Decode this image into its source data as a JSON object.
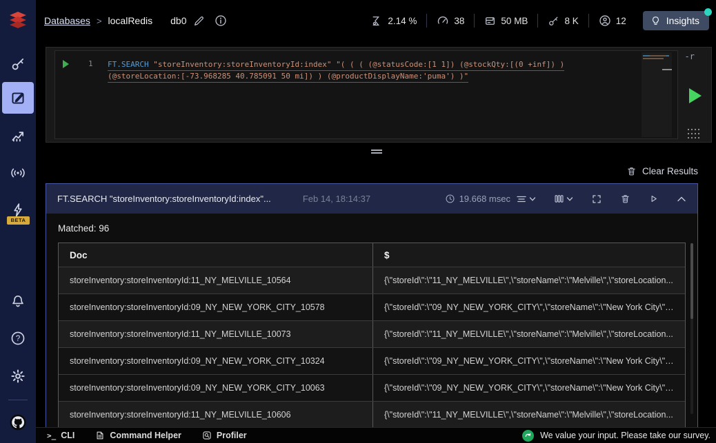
{
  "topbar": {
    "breadcrumb": {
      "databases": "Databases",
      "separator": ">",
      "database_name": "localRedis"
    },
    "db_index": "db0",
    "stats": {
      "cpu": "2.14 %",
      "commands_per_sec": "38",
      "total_memory": "50 MB",
      "total_keys": "8 K",
      "connected_clients": "12"
    },
    "insights_button": "Insights"
  },
  "sidebar": {
    "beta_badge": "BETA"
  },
  "workbench": {
    "editor": {
      "line_number": "1",
      "keyword": "FT.SEARCH",
      "code_line1_rest": " \"storeInventory:storeInventoryId:index\" \"( ( ( (@statusCode:[1 1]) (@stockQty:[(0 +inf]) )",
      "code_line2": "(@storeLocation:[-73.968285 40.785091 50 mi]) ) (@productDisplayName:'puma') )\"",
      "overlay_text": "-r"
    },
    "results": {
      "clear_results_label": "Clear Results",
      "query_card": {
        "title": "FT.SEARCH \"storeInventory:storeInventoryId:index\"...",
        "executed_at": "Feb 14, 18:14:37",
        "duration": "19.668 msec",
        "matched": "Matched: 96"
      },
      "table": {
        "columns": [
          "Doc",
          "$"
        ],
        "rows": [
          {
            "doc": "storeInventory:storeInventoryId:11_NY_MELVILLE_10564",
            "value": "{\\\"storeId\\\":\\\"11_NY_MELVILLE\\\",\\\"storeName\\\":\\\"Melville\\\",\\\"storeLocation..."
          },
          {
            "doc": "storeInventory:storeInventoryId:09_NY_NEW_YORK_CITY_10578",
            "value": "{\\\"storeId\\\":\\\"09_NY_NEW_YORK_CITY\\\",\\\"storeName\\\":\\\"New York City\\\",\\..."
          },
          {
            "doc": "storeInventory:storeInventoryId:11_NY_MELVILLE_10073",
            "value": "{\\\"storeId\\\":\\\"11_NY_MELVILLE\\\",\\\"storeName\\\":\\\"Melville\\\",\\\"storeLocation..."
          },
          {
            "doc": "storeInventory:storeInventoryId:09_NY_NEW_YORK_CITY_10324",
            "value": "{\\\"storeId\\\":\\\"09_NY_NEW_YORK_CITY\\\",\\\"storeName\\\":\\\"New York City\\\",\\..."
          },
          {
            "doc": "storeInventory:storeInventoryId:09_NY_NEW_YORK_CITY_10063",
            "value": "{\\\"storeId\\\":\\\"09_NY_NEW_YORK_CITY\\\",\\\"storeName\\\":\\\"New York City\\\",\\..."
          },
          {
            "doc": "storeInventory:storeInventoryId:11_NY_MELVILLE_10606",
            "value": "{\\\"storeId\\\":\\\"11_NY_MELVILLE\\\",\\\"storeName\\\":\\\"Melville\\\",\\\"storeLocation..."
          }
        ]
      }
    }
  },
  "bottombar": {
    "cli": "CLI",
    "command_helper": "Command Helper",
    "profiler": "Profiler",
    "survey": "We value your input. Please take our survey."
  },
  "icons": {
    "cli_prompt": ">_"
  },
  "colors": {
    "sidebar_bg": "#141c3e",
    "active_nav": "#a3b0f5",
    "accent_green": "#47d35f",
    "card_border": "#4a57a5",
    "card_header_bg": "#212847",
    "insights_dot": "#2dd4bf",
    "beta_badge_bg": "#d7aa3d",
    "keyword_blue": "#569cd6",
    "string_orange": "#ce9178",
    "logo_red": "#c6302b"
  }
}
